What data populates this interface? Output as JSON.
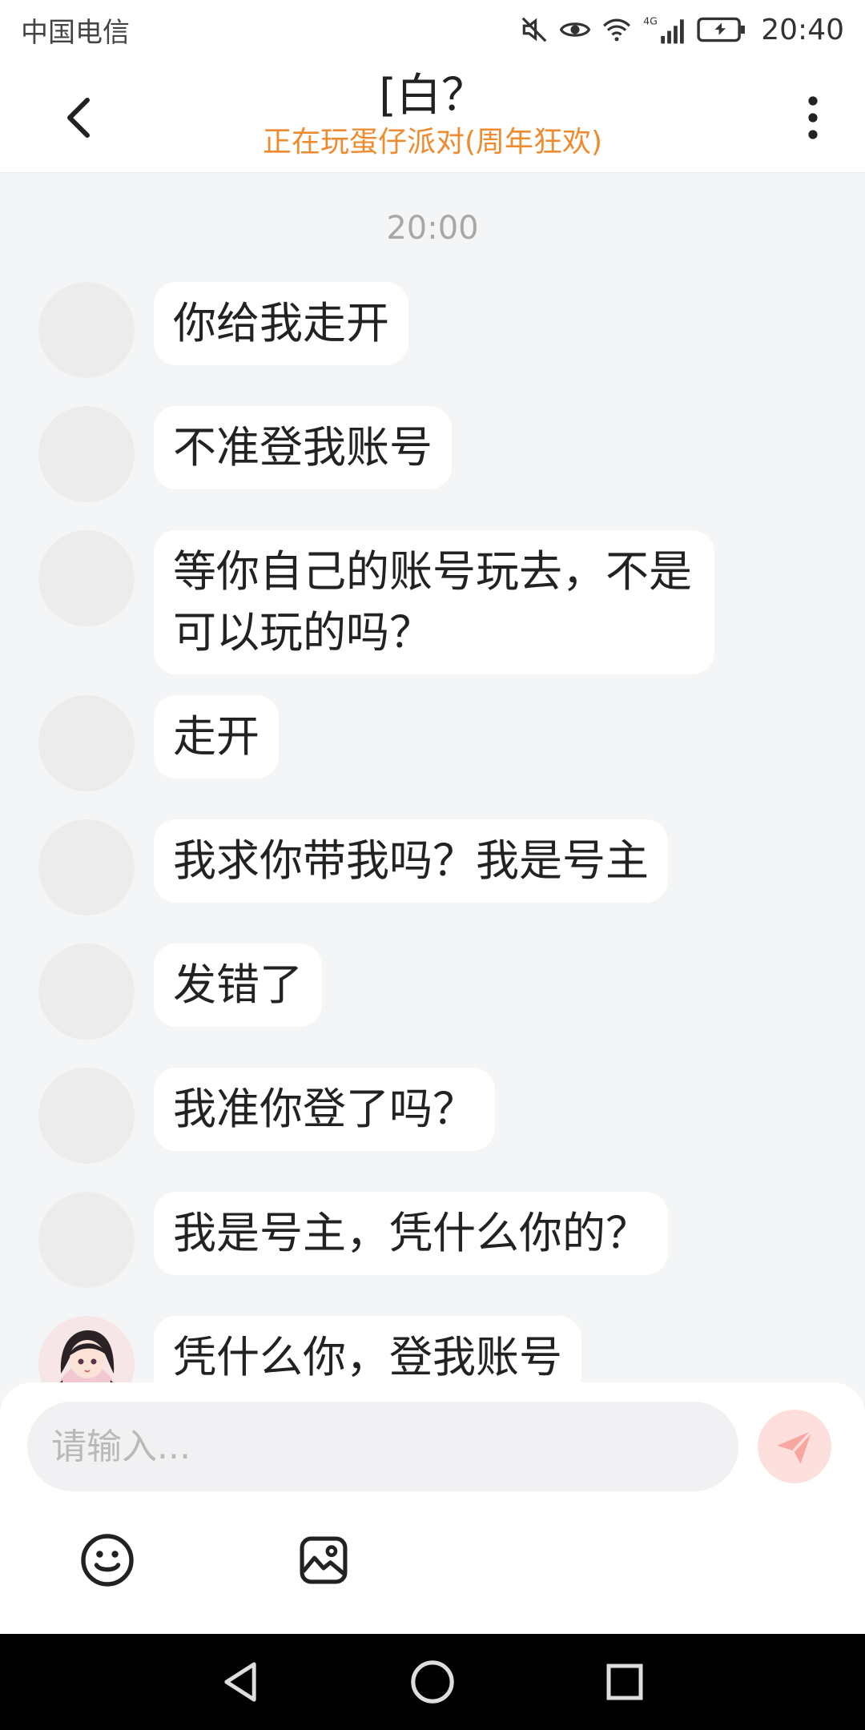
{
  "status_bar": {
    "carrier": "中国电信",
    "network_label": "4G",
    "time": "20:40"
  },
  "header": {
    "title": "[白？",
    "subtitle": "正在玩蛋仔派对(周年狂欢)"
  },
  "chat": {
    "timestamp": "20:00",
    "messages": [
      {
        "text": "你给我走开"
      },
      {
        "text": "不准登我账号"
      },
      {
        "text": "等你自己的账号玩去，不是可以玩的吗？"
      },
      {
        "text": "走开"
      },
      {
        "text": "我求你带我吗？我是号主"
      },
      {
        "text": "发错了"
      },
      {
        "text": "我准你登了吗？"
      },
      {
        "text": "我是号主，凭什么你的？"
      },
      {
        "text": "凭什么你，登我账号"
      }
    ]
  },
  "composer": {
    "placeholder": "请输入..."
  },
  "colors": {
    "subtitle": "#ef8a2f",
    "send_button_bg": "#fde0de",
    "send_icon": "#f7a7a0"
  },
  "icons": {
    "back": "chevron-left-icon",
    "more": "more-vertical-icon",
    "emoji": "smiley-icon",
    "image": "image-icon",
    "send": "send-icon"
  }
}
